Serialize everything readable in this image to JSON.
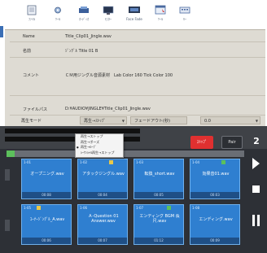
{
  "toolbar": {
    "items": [
      {
        "icon": "document-icon",
        "label": "ﾌｧｲﾙ"
      },
      {
        "icon": "settings-icon",
        "label": "ﾂｰﾙ"
      },
      {
        "icon": "audio-icon",
        "label": "ｵｰﾃﾞｨｵ"
      },
      {
        "icon": "monitor-icon",
        "label": "ﾓﾆﾀｰ"
      },
      {
        "icon": "display-icon",
        "label": "Face Fade"
      },
      {
        "icon": "window-icon",
        "label": "ﾂｰﾙ"
      },
      {
        "icon": "keyboard-icon",
        "label": "ｷｰ"
      }
    ]
  },
  "info": {
    "rows": [
      {
        "label": "Name",
        "value": "Title_Clip01_Jingle.wav"
      },
      {
        "label": "名前",
        "value": "ｼﾞﾝｸﾞﾙ Title 01 B"
      },
      {
        "label": "コメント",
        "value": "ＣＭ用ジングル音源素材　Lab Color 160 Tick Color 100"
      },
      {
        "label": "ファイルパス",
        "value": "D:¥AUDIO¥JINGLE¥Title_Clip01_Jingle.wav"
      }
    ],
    "mode_label": "再生モード",
    "mode_select": "再生→ｽﾄｯﾌﾟ",
    "fade_select": "フェードアウト(秒)",
    "fade_value": "0.0"
  },
  "mode_menu": {
    "items": [
      "再生→ストップ",
      "再生→ポーズ",
      "再生→ﾙｰﾌﾟ",
      "ｼｰｹﾝｼｬﾙ再生→ストップ"
    ],
    "selected_index": 2
  },
  "controls": {
    "stop_label": "ｽﾄｯﾌﾟ",
    "pair_label": "Pair",
    "page_number": "2"
  },
  "pads": [
    {
      "num": "1-01",
      "title": "オープニング.wav",
      "time": "00:08",
      "mark": ""
    },
    {
      "num": "1-02",
      "title": "アタックジングル.wav",
      "time": "00:04",
      "mark": "yellow"
    },
    {
      "num": "1-03",
      "title": "転換_short.wav",
      "time": "00:05",
      "mark": ""
    },
    {
      "num": "1-04",
      "title": "効果音01.wav",
      "time": "00:03",
      "mark": "green"
    },
    {
      "num": "1-05",
      "title": "ｺｰﾅｰｼﾞﾝｸﾞﾙ_A.wav",
      "time": "00:06",
      "mark": "yellow"
    },
    {
      "num": "1-06",
      "title": "Ａ-Question 01 Answer.wav",
      "time": "00:07",
      "mark": ""
    },
    {
      "num": "1-07",
      "title": "エンディング BGM 長尺.wav",
      "time": "01:12",
      "mark": "green"
    },
    {
      "num": "1-08",
      "title": "エンディング.wav",
      "time": "00:09",
      "mark": ""
    }
  ],
  "colors": {
    "accent": "#2f7fd0",
    "stop": "#e03030",
    "panel": "#dedbd3"
  }
}
